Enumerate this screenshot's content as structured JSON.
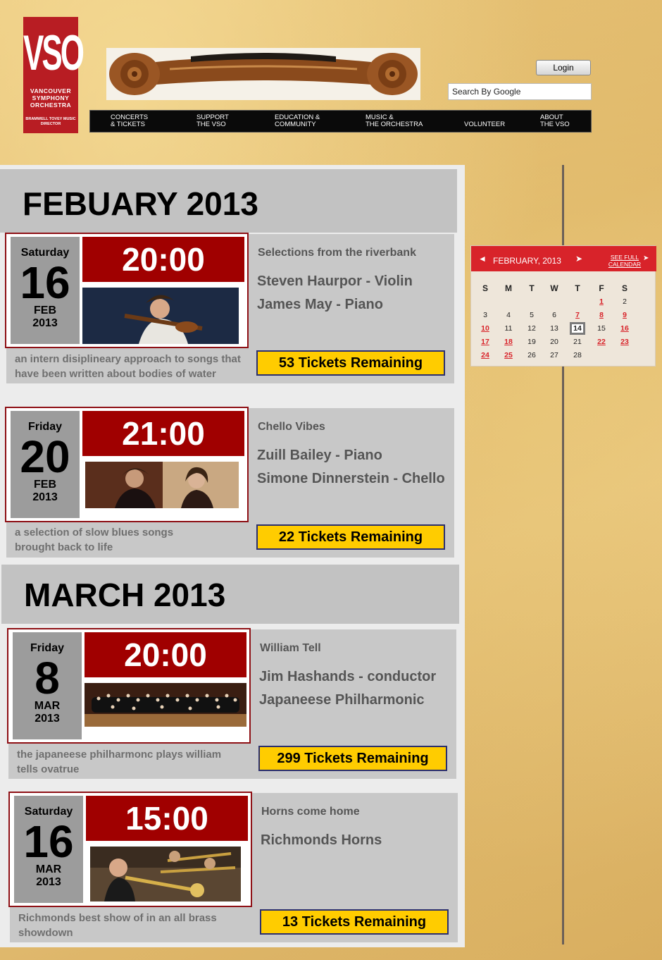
{
  "header": {
    "logo_mark": "VSO",
    "logo_name": "VANCOUVER SYMPHONY ORCHESTRA",
    "logo_sub": "BRAMWELL TOVEY MUSIC DIRECTOR",
    "login_label": "Login",
    "search_placeholder": "Search By Google"
  },
  "nav": [
    {
      "label": "CONCERTS\n& TICKETS"
    },
    {
      "label": "SUPPORT\nTHE VSO"
    },
    {
      "label": "EDUCATION &\nCOMMUNITY"
    },
    {
      "label": "MUSIC &\nTHE ORCHESTRA"
    },
    {
      "label": "VOLUNTEER"
    },
    {
      "label": "ABOUT\nTHE VSO"
    }
  ],
  "months": [
    {
      "title": "FEBUARY 2013"
    },
    {
      "title": "MARCH 2013"
    }
  ],
  "events": [
    {
      "weekday": "Saturday",
      "day": "16",
      "month": "FEB",
      "year": "2013",
      "time": "20:00",
      "title": "Selections from the riverbank",
      "performers": [
        "Steven Haurpor - Violin",
        "James May - Piano"
      ],
      "description": "an intern disiplineary approach to songs that have been written about bodies of water",
      "tickets": "53 Tickets Remaining"
    },
    {
      "weekday": "Friday",
      "day": "20",
      "month": "FEB",
      "year": "2013",
      "time": "21:00",
      "title": "Chello Vibes",
      "performers": [
        "Zuill Bailey - Piano",
        "Simone Dinnerstein - Chello"
      ],
      "description": "a selection of slow blues songs brought back to life",
      "tickets": "22 Tickets Remaining"
    },
    {
      "weekday": "Friday",
      "day": "8",
      "month": "MAR",
      "year": "2013",
      "time": "20:00",
      "title": "William Tell",
      "performers": [
        "Jim Hashands - conductor",
        "Japaneese Philharmonic"
      ],
      "description": "the japaneese philharmonc plays william tells ovatrue",
      "tickets": "299 Tickets Remaining"
    },
    {
      "weekday": "Saturday",
      "day": "16",
      "month": "MAR",
      "year": "2013",
      "time": "15:00",
      "title": "Horns come home",
      "performers": [
        "Richmonds Horns"
      ],
      "description": "Richmonds best show of in an all brass showdown",
      "tickets": "13 Tickets Remaining"
    }
  ],
  "calendar": {
    "prev": "◄",
    "month": "FEBRUARY, 2013",
    "next": "➤",
    "full_link": "SEE FULL CALENDAR",
    "full_arrow": "➤",
    "weekdays": [
      "S",
      "M",
      "T",
      "W",
      "T",
      "F",
      "S"
    ],
    "weeks": [
      [
        "",
        "",
        "",
        "",
        "",
        "1",
        "2"
      ],
      [
        "3",
        "4",
        "5",
        "6",
        "7",
        "8",
        "9"
      ],
      [
        "10",
        "11",
        "12",
        "13",
        "14",
        "15",
        "16"
      ],
      [
        "17",
        "18",
        "19",
        "20",
        "21",
        "22",
        "23"
      ],
      [
        "24",
        "25",
        "26",
        "27",
        "28",
        "",
        ""
      ]
    ],
    "event_days": [
      "1",
      "7",
      "8",
      "9",
      "10",
      "16",
      "17",
      "18",
      "22",
      "23",
      "24",
      "25"
    ],
    "today": "14",
    "accent": "#d8232a"
  }
}
